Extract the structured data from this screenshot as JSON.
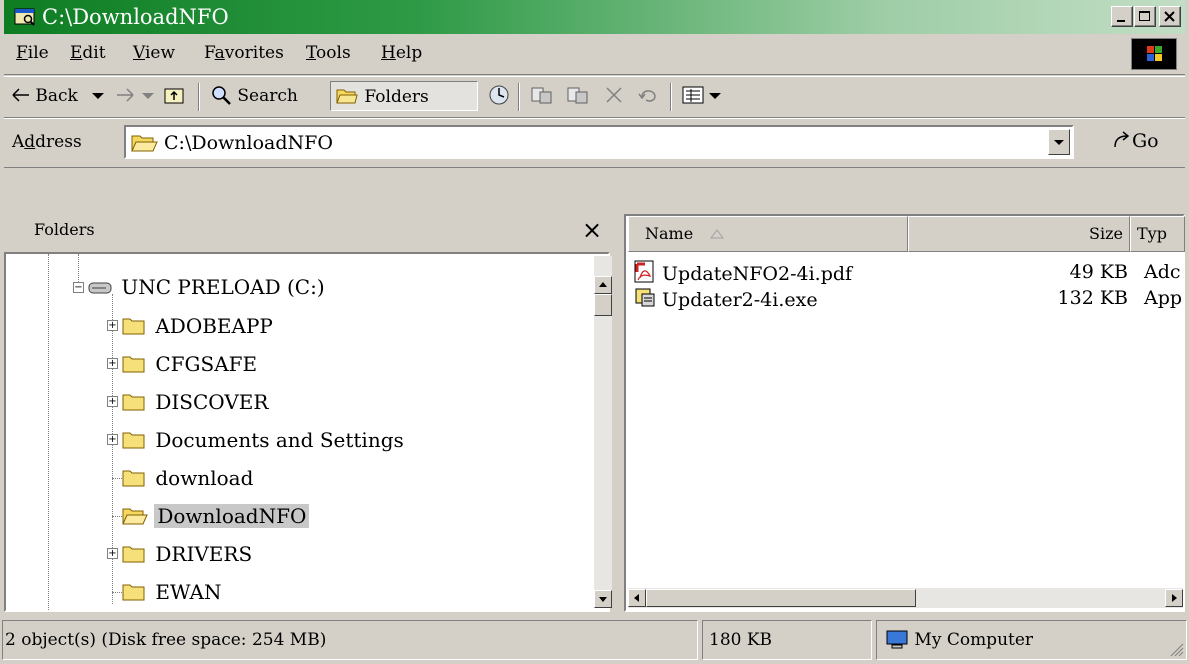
{
  "window": {
    "title": "C:\\DownloadNFO",
    "minimize_icon": "minimize-icon",
    "maximize_icon": "maximize-icon",
    "close_icon": "close-icon"
  },
  "menu": {
    "items": [
      {
        "underline": "F",
        "rest": "ile"
      },
      {
        "underline": "E",
        "rest": "dit"
      },
      {
        "underline": "V",
        "rest": "iew"
      },
      {
        "prefix": "F",
        "underline": "a",
        "rest": "vorites"
      },
      {
        "underline": "T",
        "rest": "ools"
      },
      {
        "underline": "H",
        "rest": "elp"
      }
    ]
  },
  "toolbar": {
    "back": "Back",
    "search": "Search",
    "folders": "Folders"
  },
  "address": {
    "label_prefix": "A",
    "label_underline": "d",
    "label_rest": "dress",
    "value": "C:\\DownloadNFO",
    "go": "Go"
  },
  "folders_pane": {
    "title": "Folders",
    "close": "×",
    "tree": [
      {
        "label": "UNC PRELOAD (C:)",
        "expander": "−"
      },
      {
        "label": "ADOBEAPP",
        "expander": "+"
      },
      {
        "label": "CFGSAFE",
        "expander": "+"
      },
      {
        "label": "DISCOVER",
        "expander": "+"
      },
      {
        "label": "Documents and Settings",
        "expander": "+"
      },
      {
        "label": "download"
      },
      {
        "label": "DownloadNFO"
      },
      {
        "label": "DRIVERS",
        "expander": "+"
      },
      {
        "label": "EWAN"
      }
    ]
  },
  "files_pane": {
    "columns": [
      "Name",
      "Size",
      "Typ"
    ],
    "files": [
      {
        "name": "UpdateNFO2-4i.pdf",
        "size": "49 KB",
        "type": "Adc",
        "icon": "pdf-file-icon"
      },
      {
        "name": "Updater2-4i.exe",
        "size": "132 KB",
        "type": "App",
        "icon": "exe-file-icon"
      }
    ]
  },
  "status": {
    "objects": "2 object(s) (Disk free space: 254 MB)",
    "size": "180 KB",
    "zone": "My Computer"
  }
}
